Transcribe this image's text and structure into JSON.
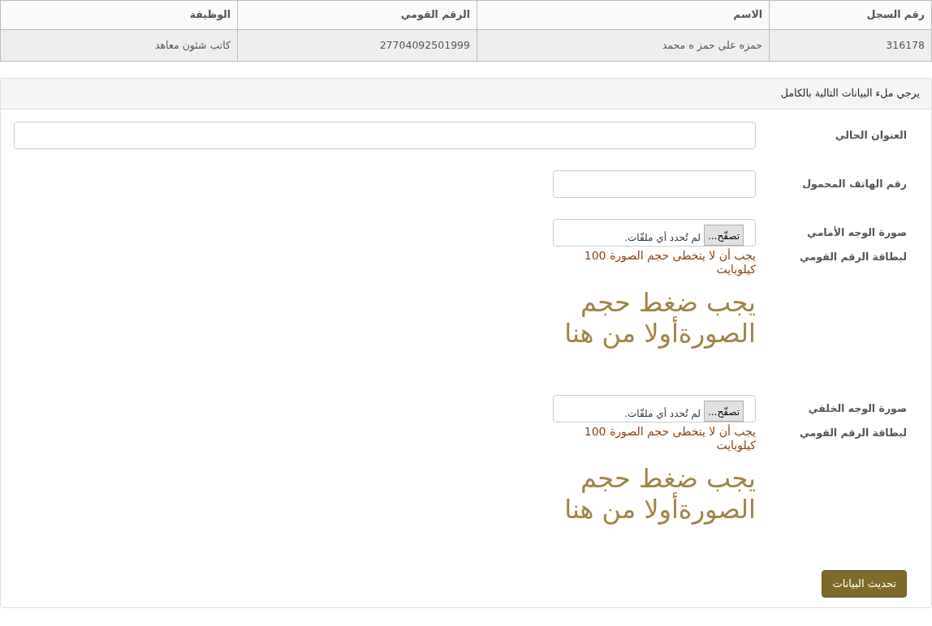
{
  "table": {
    "columns": [
      "رقم السجل",
      "الاسم",
      "الرقم القومي",
      "الوظيفة"
    ],
    "rows": [
      [
        "316178",
        "حمزه على حمز ه محمد",
        "27704092501999",
        "كاتب شئون معاهد"
      ]
    ]
  },
  "panel": {
    "heading": "يرجي ملء البيانات التالية بالكامل",
    "fields": [
      {
        "kind": "text",
        "label": "العنوان الحالي",
        "wide": true
      },
      {
        "kind": "text",
        "label": "رقم الهاتف المحمول",
        "wide": false
      },
      {
        "kind": "file",
        "label": "صورة الوجه الأمامي لبطاقة الرقم القومي",
        "button": "تصفّح...",
        "status": "لم تُحدد أي ملفّات.",
        "hint": "يجب أن لا يتخطى حجم الصورة 100 كيلوبايت",
        "link": "يجب ضغط حجم الصورةأولا من هنا"
      },
      {
        "kind": "file",
        "label": "صورة الوجه الخلفي لبطاقة الرقم القومي",
        "button": "تصفّح...",
        "status": "لم تُحدد أي ملفّات.",
        "hint": "يجب أن لا يتخطى حجم الصورة 100 كيلوبايت",
        "link": "يجب ضغط حجم الصورةأولا من هنا"
      }
    ],
    "submit": "تحديث البيانات"
  }
}
